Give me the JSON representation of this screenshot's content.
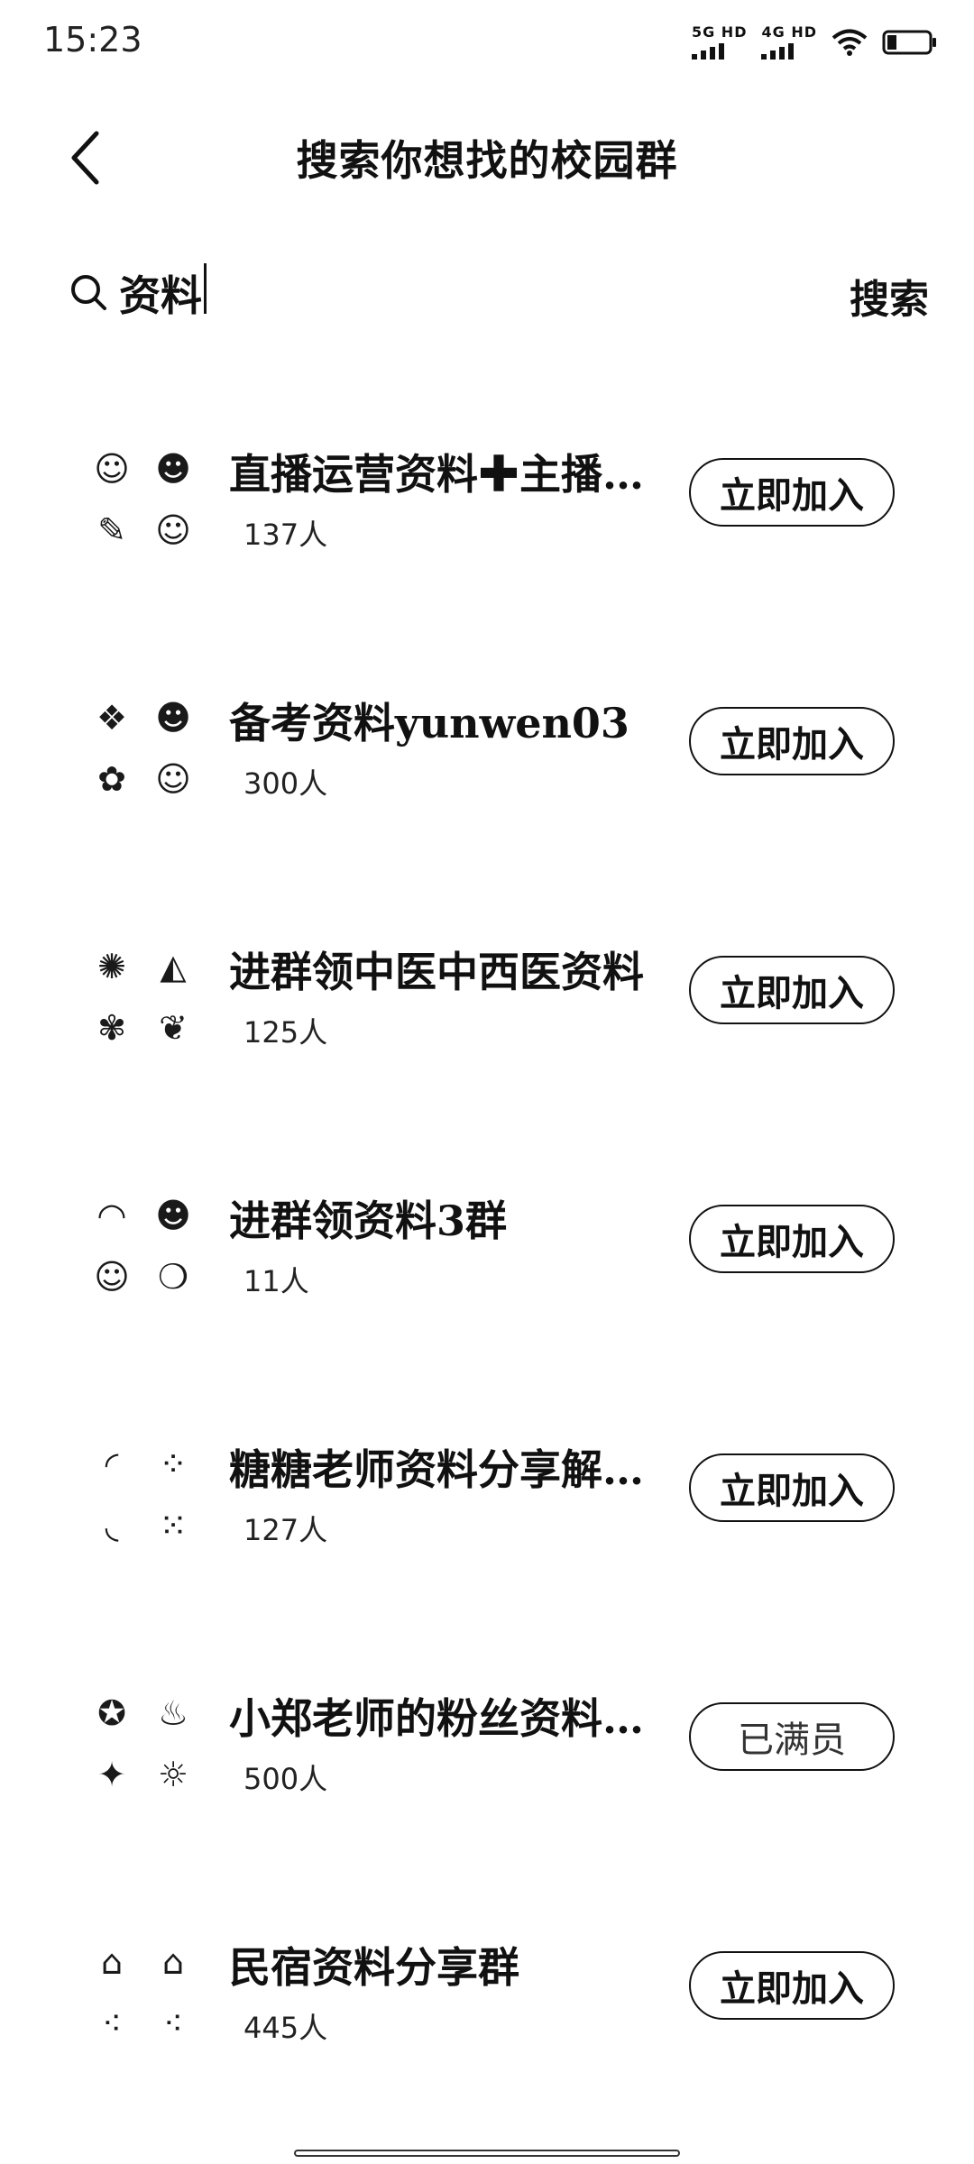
{
  "status_bar": {
    "time": "15:23",
    "sim1_label": "5G HD",
    "sim2_label": "4G HD",
    "icons": [
      "signal-icon",
      "signal-icon",
      "wifi-icon",
      "battery-icon"
    ]
  },
  "header": {
    "title": "搜索你想找的校园群",
    "back_icon": "chevron-left-icon"
  },
  "search": {
    "query": "资料",
    "button_label": "搜索",
    "icon": "search-icon"
  },
  "groups": [
    {
      "name": "直播运营资料✚主播…",
      "members": "137人",
      "action": "立即加入",
      "full": false
    },
    {
      "name": "备考资料yunwen03",
      "members": "300人",
      "action": "立即加入",
      "full": false
    },
    {
      "name": "进群领中医中西医资料",
      "members": "125人",
      "action": "立即加入",
      "full": false
    },
    {
      "name": "进群领资料3群",
      "members": "11人",
      "action": "立即加入",
      "full": false
    },
    {
      "name": "糖糖老师资料分享解…",
      "members": "127人",
      "action": "立即加入",
      "full": false
    },
    {
      "name": "小郑老师的粉丝资料…",
      "members": "500人",
      "action": "已满员",
      "full": true
    },
    {
      "name": "民宿资料分享群",
      "members": "445人",
      "action": "立即加入",
      "full": false
    }
  ]
}
